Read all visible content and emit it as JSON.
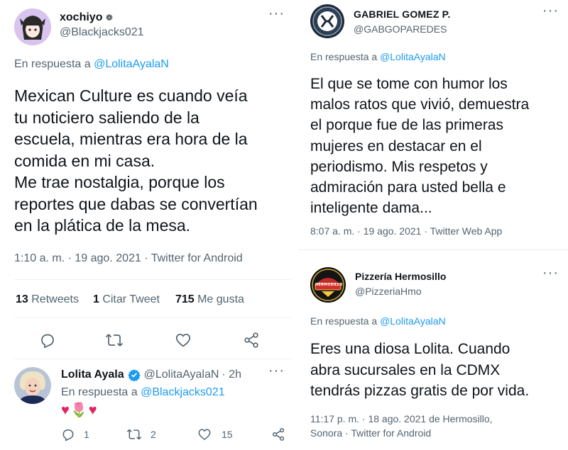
{
  "left": {
    "tweet": {
      "name": "xochiyo",
      "name_glyph": "❁",
      "handle": "@Blackjacks021",
      "reply_prefix": "En respuesta a",
      "reply_target": "@LolitaAyalaN",
      "text_lines": [
        "Mexican Culture es cuando veía",
        "tu noticiero saliendo de la",
        "escuela, mientras era hora de la",
        "comida en mi casa.",
        "Me trae nostalgia, porque los",
        "reportes que dabas se convertían",
        "en la plática de la mesa."
      ],
      "meta": "1:10 a. m. · 19 ago. 2021 · Twitter for Android",
      "retweets_num": "13",
      "retweets_lbl": "Retweets",
      "quotes_num": "1",
      "quotes_lbl": "Citar Tweet",
      "likes_num": "715",
      "likes_lbl": "Me gusta"
    },
    "reply": {
      "name": "Lolita Ayala",
      "handle": "@LolitaAyalaN",
      "time": "· 2h",
      "reply_prefix": "En respuesta a",
      "reply_target": "@Blackjacks021",
      "emojis": "♥🌷♥",
      "reply_count": "1",
      "retweet_count": "2",
      "like_count": "15"
    }
  },
  "right": {
    "tweet1": {
      "name": "GABRIEL GOMEZ P.",
      "handle": "@GABGOPAREDES",
      "reply_prefix": "En respuesta a",
      "reply_target": "@LolitaAyalaN",
      "text_lines": [
        "El que se tome con humor los",
        "malos ratos que vivió, demuestra",
        "el porque fue de las primeras",
        "mujeres en destacar en el",
        "periodismo. Mis respetos y",
        "admiración para usted bella e",
        "inteligente dama..."
      ],
      "meta": "8:07 a. m. · 19 ago. 2021 · Twitter Web App"
    },
    "tweet2": {
      "name": "Pizzería Hermosillo",
      "handle": "@PizzeriaHmo",
      "avatar_text": "HERMOSILLO",
      "reply_prefix": "En respuesta a",
      "reply_target": "@LolitaAyalaN",
      "text_lines": [
        "Eres una diosa Lolita. Cuando",
        "abra sucursales en la CDMX",
        "tendrás pizzas gratis de por vida."
      ],
      "meta_line1": "11:17 p. m. · 18 ago. 2021 de Hermosillo,",
      "meta_line2": "Sonora · Twitter for Android"
    }
  },
  "colors": {
    "text": "#0f1419",
    "secondary": "#536471",
    "link": "#1d9bf0",
    "divider": "#eff3f4",
    "verified": "#1d9bf0",
    "heart_emoji": "#e0245e"
  },
  "icons": [
    "more-icon",
    "reply-icon",
    "retweet-icon",
    "like-icon",
    "share-icon",
    "verified-icon"
  ]
}
